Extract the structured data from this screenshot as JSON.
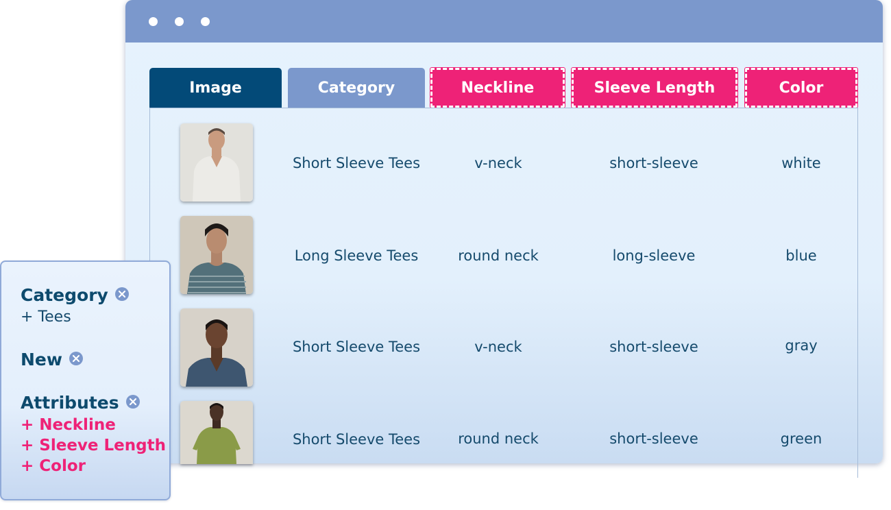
{
  "window": {
    "controls": [
      "dot",
      "dot",
      "dot"
    ]
  },
  "tabs": [
    {
      "label": "Image",
      "color": "#034a78",
      "style": "existing"
    },
    {
      "label": "Category",
      "color": "#7b98cc",
      "style": "existing"
    },
    {
      "label": "Neckline",
      "color": "#ee2277",
      "style": "new"
    },
    {
      "label": "Sleeve Length",
      "color": "#ee2277",
      "style": "new"
    },
    {
      "label": "Color",
      "color": "#ee2277",
      "style": "new"
    }
  ],
  "rows": [
    {
      "category": "Short Sleeve Tees",
      "neckline": "v-neck",
      "sleeve_length": "short-sleeve",
      "color": "white",
      "shirt_color": "#ecebe7"
    },
    {
      "category": "Long Sleeve Tees",
      "neckline": "round neck",
      "sleeve_length": "long-sleeve",
      "color": "blue",
      "shirt_color": "#53707a"
    },
    {
      "category": "Short Sleeve Tees",
      "neckline": "v-neck",
      "sleeve_length": "short-sleeve",
      "color": "gray",
      "shirt_color": "#3e5670"
    },
    {
      "category": "Short Sleeve Tees",
      "neckline": "round neck",
      "sleeve_length": "short-sleeve",
      "color": "green",
      "shirt_color": "#8a9b48"
    }
  ],
  "panel": {
    "category_title": "Category",
    "category_add": "+ Tees",
    "new_title": "New",
    "attributes_title": "Attributes",
    "attributes_add": [
      "+ Neckline",
      "+ Sleeve Length",
      "+ Color"
    ]
  },
  "colors": {
    "titlebar": "#7b98cc",
    "accent_pink": "#ee2277",
    "dark_blue": "#034a78",
    "text": "#154a6c"
  }
}
